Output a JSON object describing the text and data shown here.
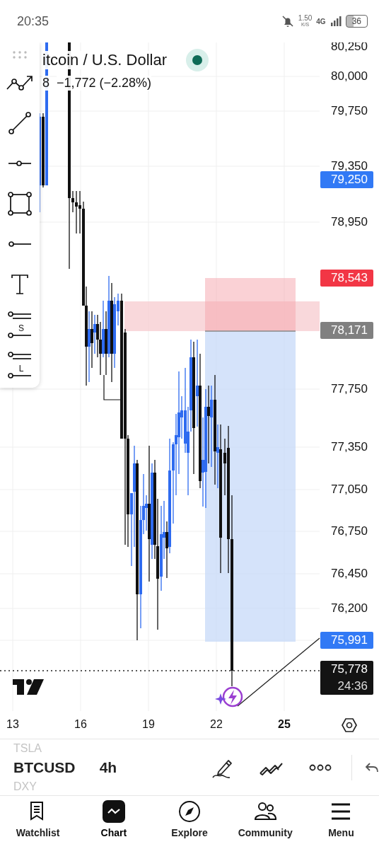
{
  "status_bar": {
    "time": "20:35",
    "net_speed": "1.50",
    "net_speed_unit": "K/S",
    "network": "4G",
    "battery": "36"
  },
  "chart": {
    "symbol_name": "itcoin / U.S. Dollar",
    "price_fragment": "8",
    "change": "−1,772 (−2.28%)",
    "market_open": true,
    "price_axis": [
      "80,250",
      "80,000",
      "79,750",
      "79,350",
      "78,950",
      "77,750",
      "77,350",
      "77,050",
      "76,750",
      "76,450",
      "76,200"
    ],
    "price_tags": [
      {
        "price": "79,250",
        "color": "#3179f5"
      },
      {
        "price": "78,543",
        "color": "#f23645"
      },
      {
        "price": "78,171",
        "color": "#808080"
      },
      {
        "price": "75,991",
        "color": "#3179f5"
      },
      {
        "price": "75,778",
        "countdown": "24:36",
        "color": "#131313"
      }
    ],
    "time_axis": [
      {
        "label": "13",
        "bold": false
      },
      {
        "label": "16",
        "bold": false
      },
      {
        "label": "19",
        "bold": false
      },
      {
        "label": "22",
        "bold": false
      },
      {
        "label": "25",
        "bold": true
      }
    ]
  },
  "drawing_tools": [
    {
      "kind": "drag"
    },
    {
      "kind": "trend-path"
    },
    {
      "kind": "line"
    },
    {
      "kind": "ray-point"
    },
    {
      "kind": "rectangle"
    },
    {
      "kind": "ray"
    },
    {
      "kind": "text"
    },
    {
      "kind": "position",
      "label": "S"
    },
    {
      "kind": "position",
      "label": "L"
    }
  ],
  "symbol_bar": {
    "previous": "TSLA",
    "symbol": "BTCUSD",
    "next": "DXY",
    "interval": "4h"
  },
  "nav": [
    {
      "label": "Watchlist",
      "selected": false
    },
    {
      "label": "Chart",
      "selected": true
    },
    {
      "label": "Explore",
      "selected": false
    },
    {
      "label": "Community",
      "selected": false
    },
    {
      "label": "Menu",
      "selected": false
    }
  ]
}
